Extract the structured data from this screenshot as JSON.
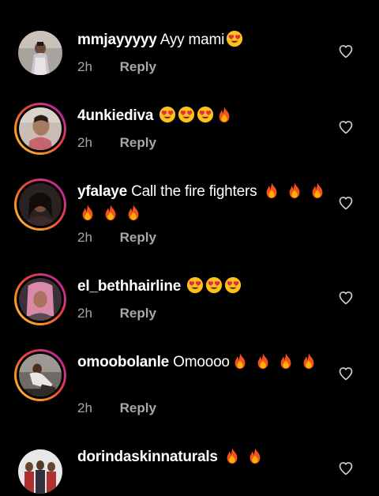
{
  "comments": [
    {
      "username": "mmjayyyyy",
      "text": "Ayy mami",
      "emojis": [
        "heart-eyes"
      ],
      "time": "2h",
      "reply_label": "Reply"
    },
    {
      "username": "4unkiediva",
      "text": "",
      "emojis": [
        "heart-eyes",
        "heart-eyes",
        "heart-eyes",
        "fire"
      ],
      "time": "2h",
      "reply_label": "Reply"
    },
    {
      "username": "yfalaye",
      "text": "Call the fire fighters",
      "emojis": [
        "fire",
        "fire",
        "fire",
        "fire",
        "fire",
        "fire"
      ],
      "time": "2h",
      "reply_label": "Reply"
    },
    {
      "username": "el_bethhairline",
      "text": "",
      "emojis": [
        "heart-eyes",
        "heart-eyes",
        "heart-eyes"
      ],
      "time": "2h",
      "reply_label": "Reply"
    },
    {
      "username": "omoobolanle",
      "text": "Omoooo",
      "emojis": [
        "fire",
        "fire",
        "fire",
        "fire"
      ],
      "time": "2h",
      "reply_label": "Reply"
    },
    {
      "username": "dorindaskinnaturals",
      "text": "",
      "emojis": [
        "fire",
        "fire"
      ]
    }
  ],
  "colors": {
    "background": "#000000",
    "text": "#ffffff",
    "meta": "#a8a8a8",
    "story_ring_start": "#f9c74f",
    "story_ring_end": "#b1218f"
  }
}
